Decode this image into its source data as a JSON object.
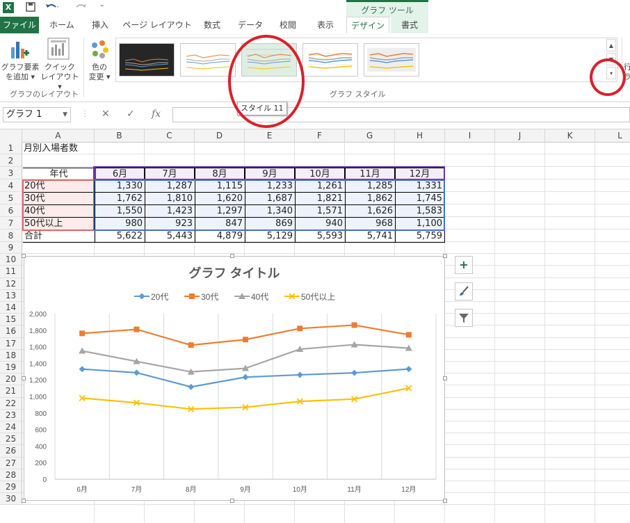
{
  "quick_access": {
    "excel_icon": "X",
    "save_icon": "save-icon",
    "undo_icon": "undo-icon",
    "redo_icon": "redo-icon",
    "more_icon": "customize-icon"
  },
  "contextual_tab_header": "グラフ ツール",
  "tabs": [
    "ファイル",
    "ホーム",
    "挿入",
    "ページ レイアウト",
    "数式",
    "データ",
    "校閲",
    "表示",
    "デザイン",
    "書式"
  ],
  "ribbon": {
    "add_element_label": [
      "グラフ要素",
      "を追加 ▾"
    ],
    "quick_layout_label": [
      "クイック",
      "レイアウト ▾"
    ],
    "change_colors_label": [
      "色の",
      "変更 ▾"
    ],
    "group_layout": "グラフのレイアウト",
    "group_styles": "グラフ スタイル",
    "right_cutoff_label": [
      "行",
      "ラ"
    ]
  },
  "tooltip": "スタイル 11",
  "formula_bar": {
    "name_box": "グラフ 1",
    "cancel_icon": "✕",
    "enter_icon": "✓",
    "fx": "fx",
    "value": ""
  },
  "columns": [
    "A",
    "B",
    "C",
    "D",
    "E",
    "F",
    "G",
    "H",
    "I",
    "J",
    "K",
    "L"
  ],
  "rows": [
    "1",
    "2",
    "3",
    "4",
    "5",
    "6",
    "7",
    "8",
    "9",
    "10",
    "11",
    "12",
    "13",
    "14",
    "15",
    "16",
    "17",
    "18",
    "19",
    "20",
    "21",
    "22",
    "23",
    "24",
    "25",
    "26",
    "27",
    "28",
    "29",
    "30"
  ],
  "sheet": {
    "title": "月別入場者数",
    "header_label": "年代",
    "months": [
      "6月",
      "7月",
      "8月",
      "9月",
      "10月",
      "11月",
      "12月"
    ],
    "data_rows": [
      {
        "label": "20代",
        "values": [
          "1,330",
          "1,287",
          "1,115",
          "1,233",
          "1,261",
          "1,285",
          "1,331"
        ]
      },
      {
        "label": "30代",
        "values": [
          "1,762",
          "1,810",
          "1,620",
          "1,687",
          "1,821",
          "1,862",
          "1,745"
        ]
      },
      {
        "label": "40代",
        "values": [
          "1,550",
          "1,423",
          "1,297",
          "1,340",
          "1,571",
          "1,626",
          "1,583"
        ]
      },
      {
        "label": "50代以上",
        "values": [
          "980",
          "923",
          "847",
          "869",
          "940",
          "968",
          "1,100"
        ]
      }
    ],
    "total_row": {
      "label": "合計",
      "values": [
        "5,622",
        "5,443",
        "4,879",
        "5,129",
        "5,593",
        "5,741",
        "5,759"
      ]
    }
  },
  "chart_buttons": {
    "add": "+",
    "style": "brush-icon",
    "filter": "filter-icon"
  },
  "colors": {
    "excel_green": "#217346",
    "annotation_red": "#d9212a",
    "s20": "#5b9bd5",
    "s30": "#ed7d31",
    "s40": "#a5a5a5",
    "s50": "#ffc000"
  },
  "chart_data": {
    "type": "line",
    "title": "グラフ タイトル",
    "categories": [
      "6月",
      "7月",
      "8月",
      "9月",
      "10月",
      "11月",
      "12月"
    ],
    "series": [
      {
        "name": "20代",
        "marker": "diamond",
        "color": "#5b9bd5",
        "values": [
          1330,
          1287,
          1115,
          1233,
          1261,
          1285,
          1331
        ]
      },
      {
        "name": "30代",
        "marker": "square",
        "color": "#ed7d31",
        "values": [
          1762,
          1810,
          1620,
          1687,
          1821,
          1862,
          1745
        ]
      },
      {
        "name": "40代",
        "marker": "triangle",
        "color": "#a5a5a5",
        "values": [
          1550,
          1423,
          1297,
          1340,
          1571,
          1626,
          1583
        ]
      },
      {
        "name": "50代以上",
        "marker": "x",
        "color": "#ffc000",
        "values": [
          980,
          923,
          847,
          869,
          940,
          968,
          1100
        ]
      }
    ],
    "ylim": [
      0,
      2000
    ],
    "yticks": [
      "0",
      "200",
      "400",
      "600",
      "800",
      "1,000",
      "1,200",
      "1,400",
      "1,600",
      "1,800",
      "2,000"
    ],
    "grid": true,
    "legend": "top"
  }
}
